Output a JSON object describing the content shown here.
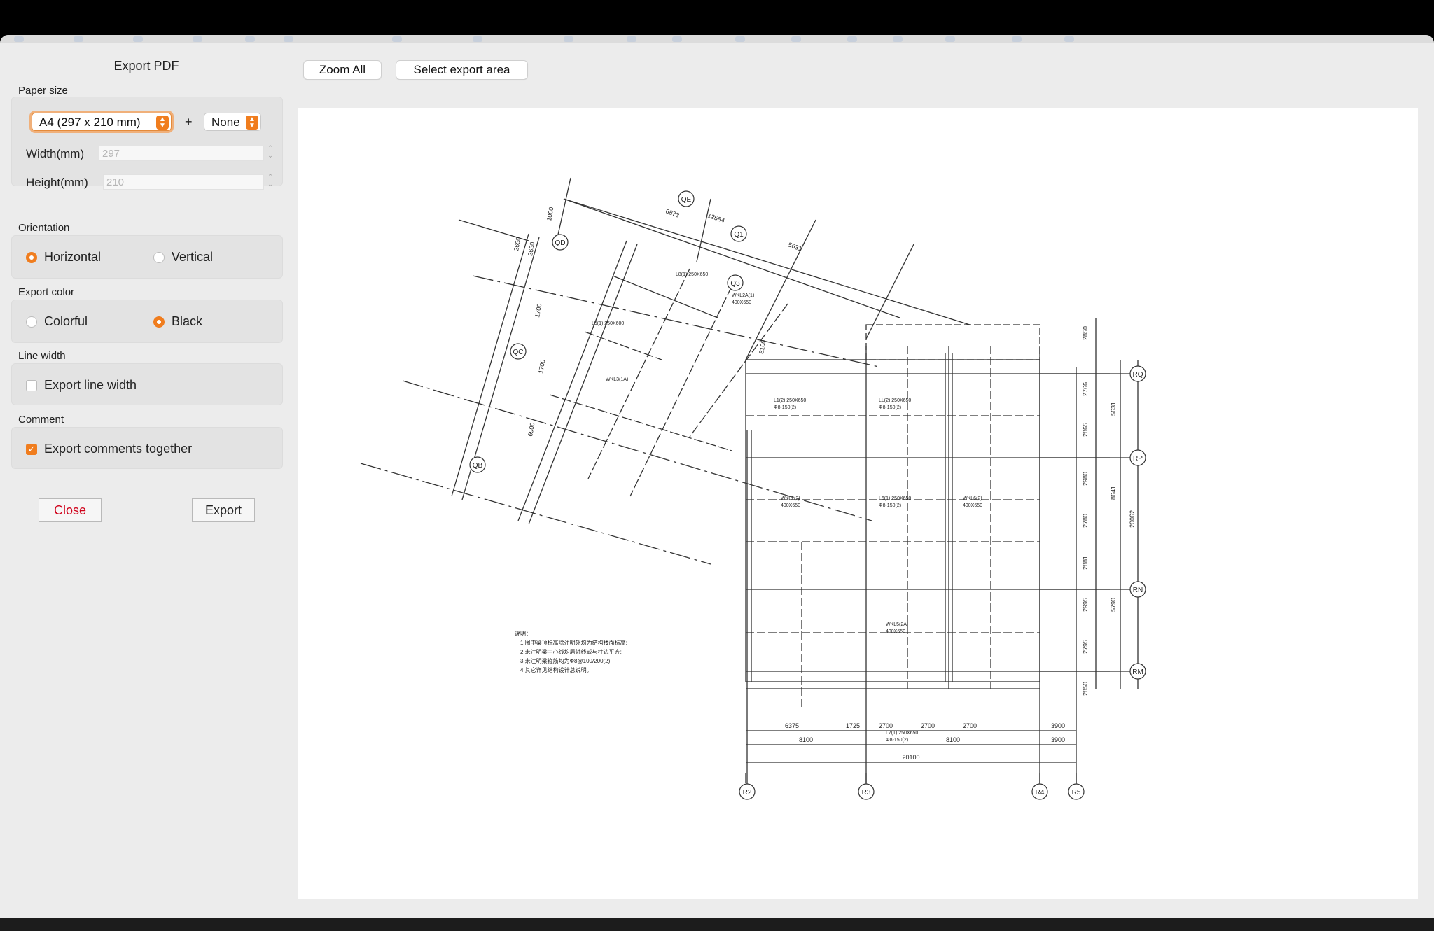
{
  "dialog": {
    "title": "Export PDF",
    "zoom_all_label": "Zoom All",
    "select_area_label": "Select export area"
  },
  "paper_size": {
    "section_label": "Paper size",
    "selected_size": "A4 (297 x 210 mm)",
    "plus": "+",
    "extra_selected": "None",
    "width_label": "Width(mm)",
    "width_value": "297",
    "height_label": "Height(mm)",
    "height_value": "210"
  },
  "orientation": {
    "section_label": "Orientation",
    "options": [
      "Horizontal",
      "Vertical"
    ],
    "selected": "Horizontal"
  },
  "export_color": {
    "section_label": "Export color",
    "options": [
      "Colorful",
      "Black"
    ],
    "selected": "Black"
  },
  "line_width": {
    "section_label": "Line width",
    "checkbox_label": "Export line width",
    "checked": false
  },
  "comment": {
    "section_label": "Comment",
    "checkbox_label": "Export comments together",
    "checked": true
  },
  "buttons": {
    "close_label": "Close",
    "export_label": "Export"
  },
  "drawing": {
    "axis_bubbles": [
      "RQ",
      "RP",
      "RN",
      "RM",
      "R2",
      "R3",
      "R4",
      "R5",
      "QD",
      "QC",
      "QB",
      "QE",
      "Q1",
      "Q3"
    ],
    "right_dims": [
      "2850",
      "2766",
      "2865",
      "2980",
      "2780",
      "2881",
      "2995",
      "2795",
      "2850"
    ],
    "right_totals": [
      "5631",
      "8641",
      "5790",
      "20062"
    ],
    "bottom_dims_row1": [
      "6375",
      "1725",
      "2700",
      "2700",
      "2700",
      "3900"
    ],
    "bottom_dims_row2": [
      "8100",
      "8100",
      "3900"
    ],
    "bottom_total": "20100",
    "top_dims": [
      "12584",
      "6873",
      "5631",
      "8100",
      "1000",
      "2650",
      "2650",
      "6900",
      "1700",
      "1700"
    ],
    "notes_title": "说明：",
    "notes": [
      "1.图中梁顶标高除注明外均为结构楼面标高;",
      "2.未注明梁中心线均居轴线或与柱边平齐;",
      "3.未注明梁箍筋均为Φ8@100/200(2);",
      "4.其它详见结构设计总说明。"
    ]
  },
  "colors": {
    "accent": "#f07d1e",
    "close_text": "#d0021b"
  }
}
